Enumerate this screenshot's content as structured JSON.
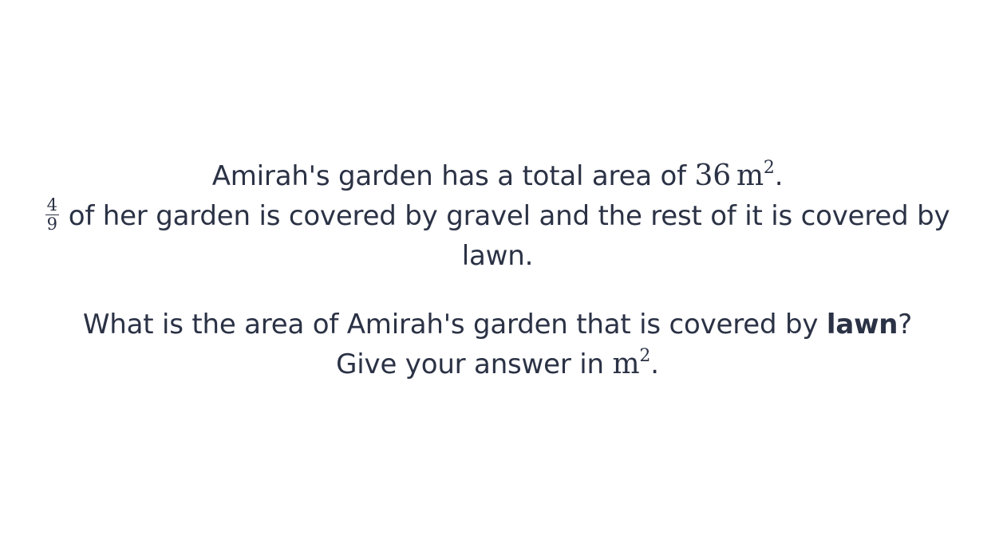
{
  "question": {
    "line1": {
      "text": "Amirah's garden has a total area of ",
      "value": "36",
      "unit": "m",
      "exponent": "2",
      "end": "."
    },
    "line2": {
      "fraction_numerator": "4",
      "fraction_denominator": "9",
      "text": "of her garden is covered by gravel and the rest of it is covered by"
    },
    "line3": {
      "text": "lawn."
    },
    "line4": {
      "text_before": "What is the area of Amirah's garden that is covered by ",
      "bold": "lawn",
      "text_after": "?"
    },
    "line5": {
      "text": "Give your answer in ",
      "unit": "m",
      "exponent": "2",
      "end": "."
    }
  }
}
